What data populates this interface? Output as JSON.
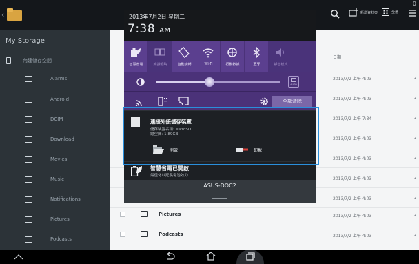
{
  "file_manager": {
    "top_clock": "0",
    "add_label": "新增資料夾",
    "select_label": "全選",
    "sidebar_title": "My Storage",
    "sidebar_root": "內建儲存空間",
    "sidebar_items": [
      "Alarms",
      "Android",
      "DCIM",
      "Download",
      "Movies",
      "Music",
      "Notifications",
      "Pictures",
      "Podcasts"
    ],
    "column_date": "日期",
    "row_dates": [
      "2013/7/2 上午 4:03",
      "2013/7/2 上午 4:03",
      "2013/7/2 上午 7:34",
      "2013/7/2 上午 4:03",
      "2013/7/2 上午 4:03",
      "2013/7/2 上午 4:03",
      "2013/7/2 上午 4:03",
      "2013/7/2 上午 4:03",
      "2013/7/2 上午 4:03"
    ],
    "visible_rows": [
      "Pictures",
      "Podcasts"
    ]
  },
  "shade": {
    "date": "2013年7月2日 星期二",
    "time": "7:38",
    "ampm": "AM",
    "quick_settings": [
      {
        "label": "智慧省電",
        "icon": "power-saving-icon",
        "dim": false
      },
      {
        "label": "朗讀眼睛",
        "icon": "reading-mode-icon",
        "dim": true
      },
      {
        "label": "自動旋轉",
        "icon": "auto-rotate-icon",
        "dim": false
      },
      {
        "label": "Wi-Fi",
        "icon": "wifi-icon",
        "dim": false
      },
      {
        "label": "行動數據",
        "icon": "mobile-data-icon",
        "dim": false
      },
      {
        "label": "藍牙",
        "icon": "bluetooth-icon",
        "dim": false
      },
      {
        "label": "靜音模式",
        "icon": "silent-mode-icon",
        "dim": true
      }
    ],
    "brightness_level": 0.43,
    "auto_label": "AUTO",
    "clear_all_label": "全部清除",
    "usb_notification": {
      "title": "連接外接儲存裝置",
      "line1": "儲存裝置名稱: MicroSD",
      "line2": "總空間: 1.89GB",
      "open_label": "開啟",
      "eject_label": "卸載"
    },
    "power_notification": {
      "title": "智慧省電已開啟",
      "subtitle": "最佳化以延長電池效力"
    },
    "device_name": "ASUS-DOC2"
  },
  "colors": {
    "shade_purple": "#5b3f8f",
    "highlight_blue": "#2a8fdc"
  }
}
